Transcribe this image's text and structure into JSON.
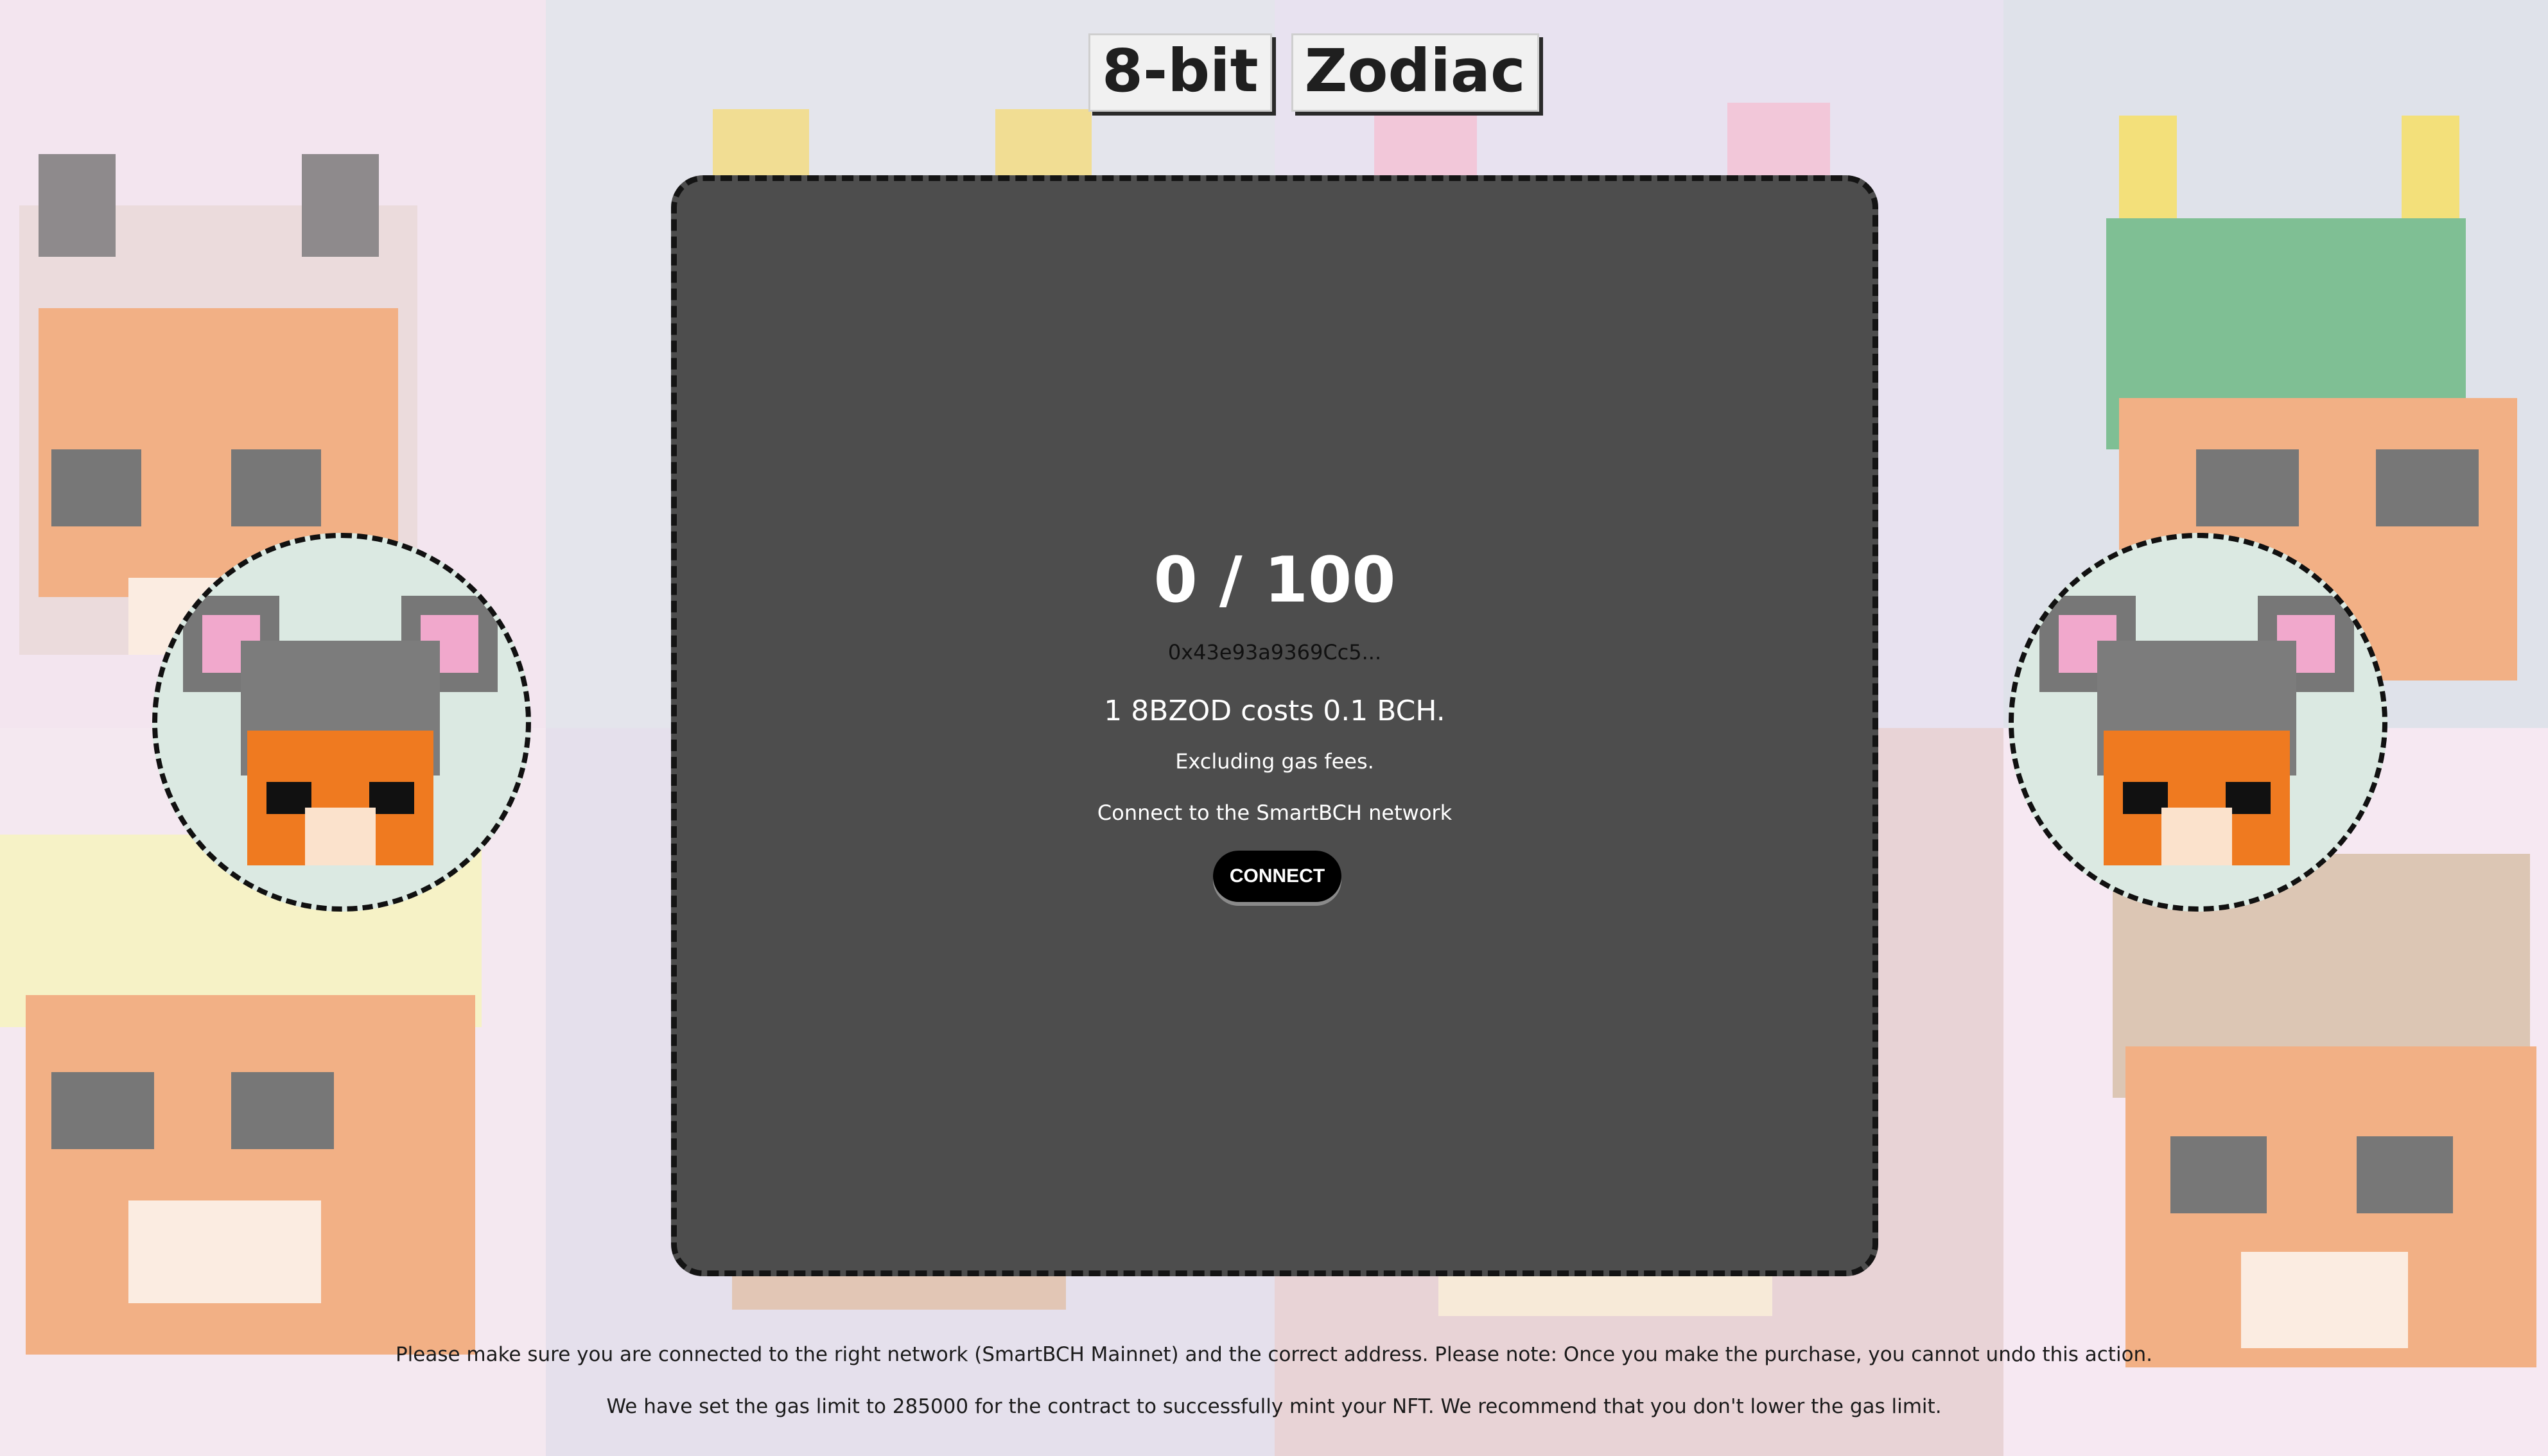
{
  "logo": {
    "word1": "8-bit",
    "word2": "Zodiac"
  },
  "mint": {
    "counter": "0 / 100",
    "address": "0x43e93a9369Cc5...",
    "price_text": "1 8BZOD costs 0.1 BCH.",
    "gas_text": "Excluding gas fees.",
    "network_text": "Connect to the SmartBCH network",
    "connect_label": "CONNECT"
  },
  "footer": {
    "line1": "Please make sure you are connected to the right network (SmartBCH Mainnet) and the correct address. Please note: Once you make the purchase, you cannot undo this action.",
    "line2": "We have set the gas limit to 285000 for the contract to successfully mint your NFT. We recommend that you don't lower the gas limit."
  },
  "colors": {
    "card_bg": "#4d4d4d",
    "badge_bg": "#dbe9e2",
    "button_bg": "#000000"
  },
  "icons": {
    "badge": "mouse-hooded-tiger-pixel-icon"
  }
}
